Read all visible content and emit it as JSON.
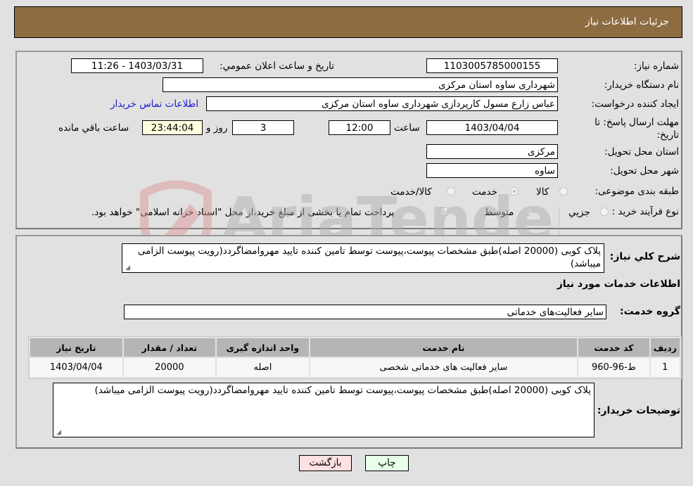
{
  "header": {
    "title": "جزئیات اطلاعات نیاز"
  },
  "form": {
    "need_number": {
      "label": "شماره نیاز:",
      "value": "1103005785000155"
    },
    "announce_datetime": {
      "label": "تاریخ و ساعت اعلان عمومي:",
      "value": "1403/03/31 - 11:26"
    },
    "buyer_org": {
      "label": "نام دستگاه خریدار:",
      "value": "شهرداری ساوه استان مرکزی"
    },
    "requester": {
      "label": "ایجاد کننده درخواست:",
      "value": "عباس زارع مسول کارپردازی شهرداری ساوه استان مرکزی"
    },
    "buyer_contact_link": "اطلاعات تماس خریدار",
    "deadline": {
      "label": "مهلت ارسال پاسخ: تا تاریخ:",
      "date": "1403/04/04",
      "time_label": "ساعت",
      "time": "12:00",
      "days": "3",
      "days_label": "روز و",
      "remaining": "23:44:04",
      "remaining_label": "ساعت باقي مانده"
    },
    "delivery_province": {
      "label": "استان محل تحویل:",
      "value": "مرکزی"
    },
    "delivery_city": {
      "label": "شهر محل تحویل:",
      "value": "ساوه"
    },
    "category": {
      "label": "طبقه بندی موضوعی:",
      "options": [
        "کالا",
        "خدمت",
        "کالا/خدمت"
      ],
      "selected": "خدمت"
    },
    "purchase_type": {
      "label": "نوع فرآیند خرید :",
      "options": [
        "جزیي",
        "متوسط"
      ],
      "selected": "",
      "treasury_checkbox_label": "پرداخت تمام یا بخشی از مبلغ خرید،از محل \"اسناد خزانه اسلامی\" خواهد بود.",
      "treasury_checked": false
    }
  },
  "details": {
    "summary_label": "شرح کلي نیاز:",
    "summary_text": "پلاک کوبی (20000 اصله)طبق مشخصات پیوست،پیوست توسط تامین کننده تایید مهروامضاگردد(رویت پیوست الزامی میباشد)",
    "services_heading": "اطلاعات خدمات مورد نیاز",
    "service_group_label": "گروه خدمت:",
    "service_group_value": "سایر فعالیت‌های خدماتی",
    "table": {
      "headers": [
        "ردیف",
        "کد خدمت",
        "نام خدمت",
        "واحد اندازه گیری",
        "تعداد / مقدار",
        "تاریخ نیاز"
      ],
      "rows": [
        [
          "1",
          "ط-96-960",
          "سایر فعالیت های خدماتی شخصی",
          "اصله",
          "20000",
          "1403/04/04"
        ]
      ]
    },
    "buyer_notes_label": "توضیحات خریدار:",
    "buyer_notes_text": "پلاک کوبی (20000 اصله)طبق مشخصات پیوست،پیوست توسط تامین کننده تایید مهروامضاگردد(رویت پیوست الزامی میباشد)"
  },
  "buttons": {
    "print": "چاپ",
    "back": "بازگشت"
  },
  "watermark": {
    "text": "AriaTender.neT"
  },
  "colors": {
    "header_bg": "#8d6c42",
    "link": "#1a1acc",
    "remaining_bg": "#ffffe0",
    "back_btn": "#ffe0e0",
    "print_btn": "#e8ffe8"
  }
}
